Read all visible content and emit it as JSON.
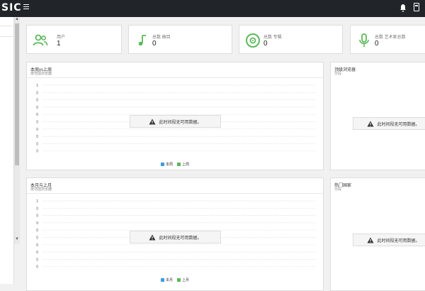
{
  "app": {
    "brand": "SIC"
  },
  "stats": [
    {
      "label": "用户",
      "value": "1",
      "icon": "users-icon",
      "color": "#5cb85c"
    },
    {
      "label": "总数 曲目",
      "value": "0",
      "icon": "music-note-icon",
      "color": "#5cb85c"
    },
    {
      "label": "总数 专辑",
      "value": "0",
      "icon": "disc-icon",
      "color": "#5cb85c"
    },
    {
      "label": "总数 艺术家总数",
      "value": "0",
      "icon": "microphone-icon",
      "color": "#5cb85c"
    }
  ],
  "panels": {
    "week": {
      "title": "本周vs上周",
      "subtitle": "按范围浏览器",
      "nodata": "此时间段无可用数据。",
      "yticks": [
        "1",
        "0",
        "0",
        "0",
        "0",
        "0",
        "0",
        "0",
        "0",
        "0"
      ],
      "legend": [
        {
          "name": "本周",
          "color": "#3c9be0"
        },
        {
          "name": "上周",
          "color": "#5cb85c"
        }
      ]
    },
    "month": {
      "title": "本月与上月",
      "subtitle": "按范围浏览器",
      "nodata": "此时间段无可用数据。",
      "yticks": [
        "1",
        "0",
        "0",
        "0",
        "0",
        "0",
        "0",
        "0",
        "0",
        "0"
      ],
      "legend": [
        {
          "name": "本月",
          "color": "#3c9be0"
        },
        {
          "name": "上月",
          "color": "#5cb85c"
        }
      ]
    },
    "browsers": {
      "title": "顶级浏览器",
      "subtitle": "分段",
      "nodata": "此时间段无可用数据。"
    },
    "countries": {
      "title": "热门国家",
      "subtitle": "分段",
      "nodata": "此时间段无可用数据。"
    }
  },
  "chart_data": [
    {
      "type": "line",
      "title": "本周vs上周",
      "series": [
        {
          "name": "本周",
          "values": []
        },
        {
          "name": "上周",
          "values": []
        }
      ],
      "yticks": [
        "1",
        "0",
        "0",
        "0",
        "0",
        "0",
        "0",
        "0",
        "0",
        "0"
      ]
    },
    {
      "type": "line",
      "title": "本月与上月",
      "series": [
        {
          "name": "本月",
          "values": []
        },
        {
          "name": "上月",
          "values": []
        }
      ],
      "yticks": [
        "1",
        "0",
        "0",
        "0",
        "0",
        "0",
        "0",
        "0",
        "0",
        "0"
      ]
    }
  ]
}
